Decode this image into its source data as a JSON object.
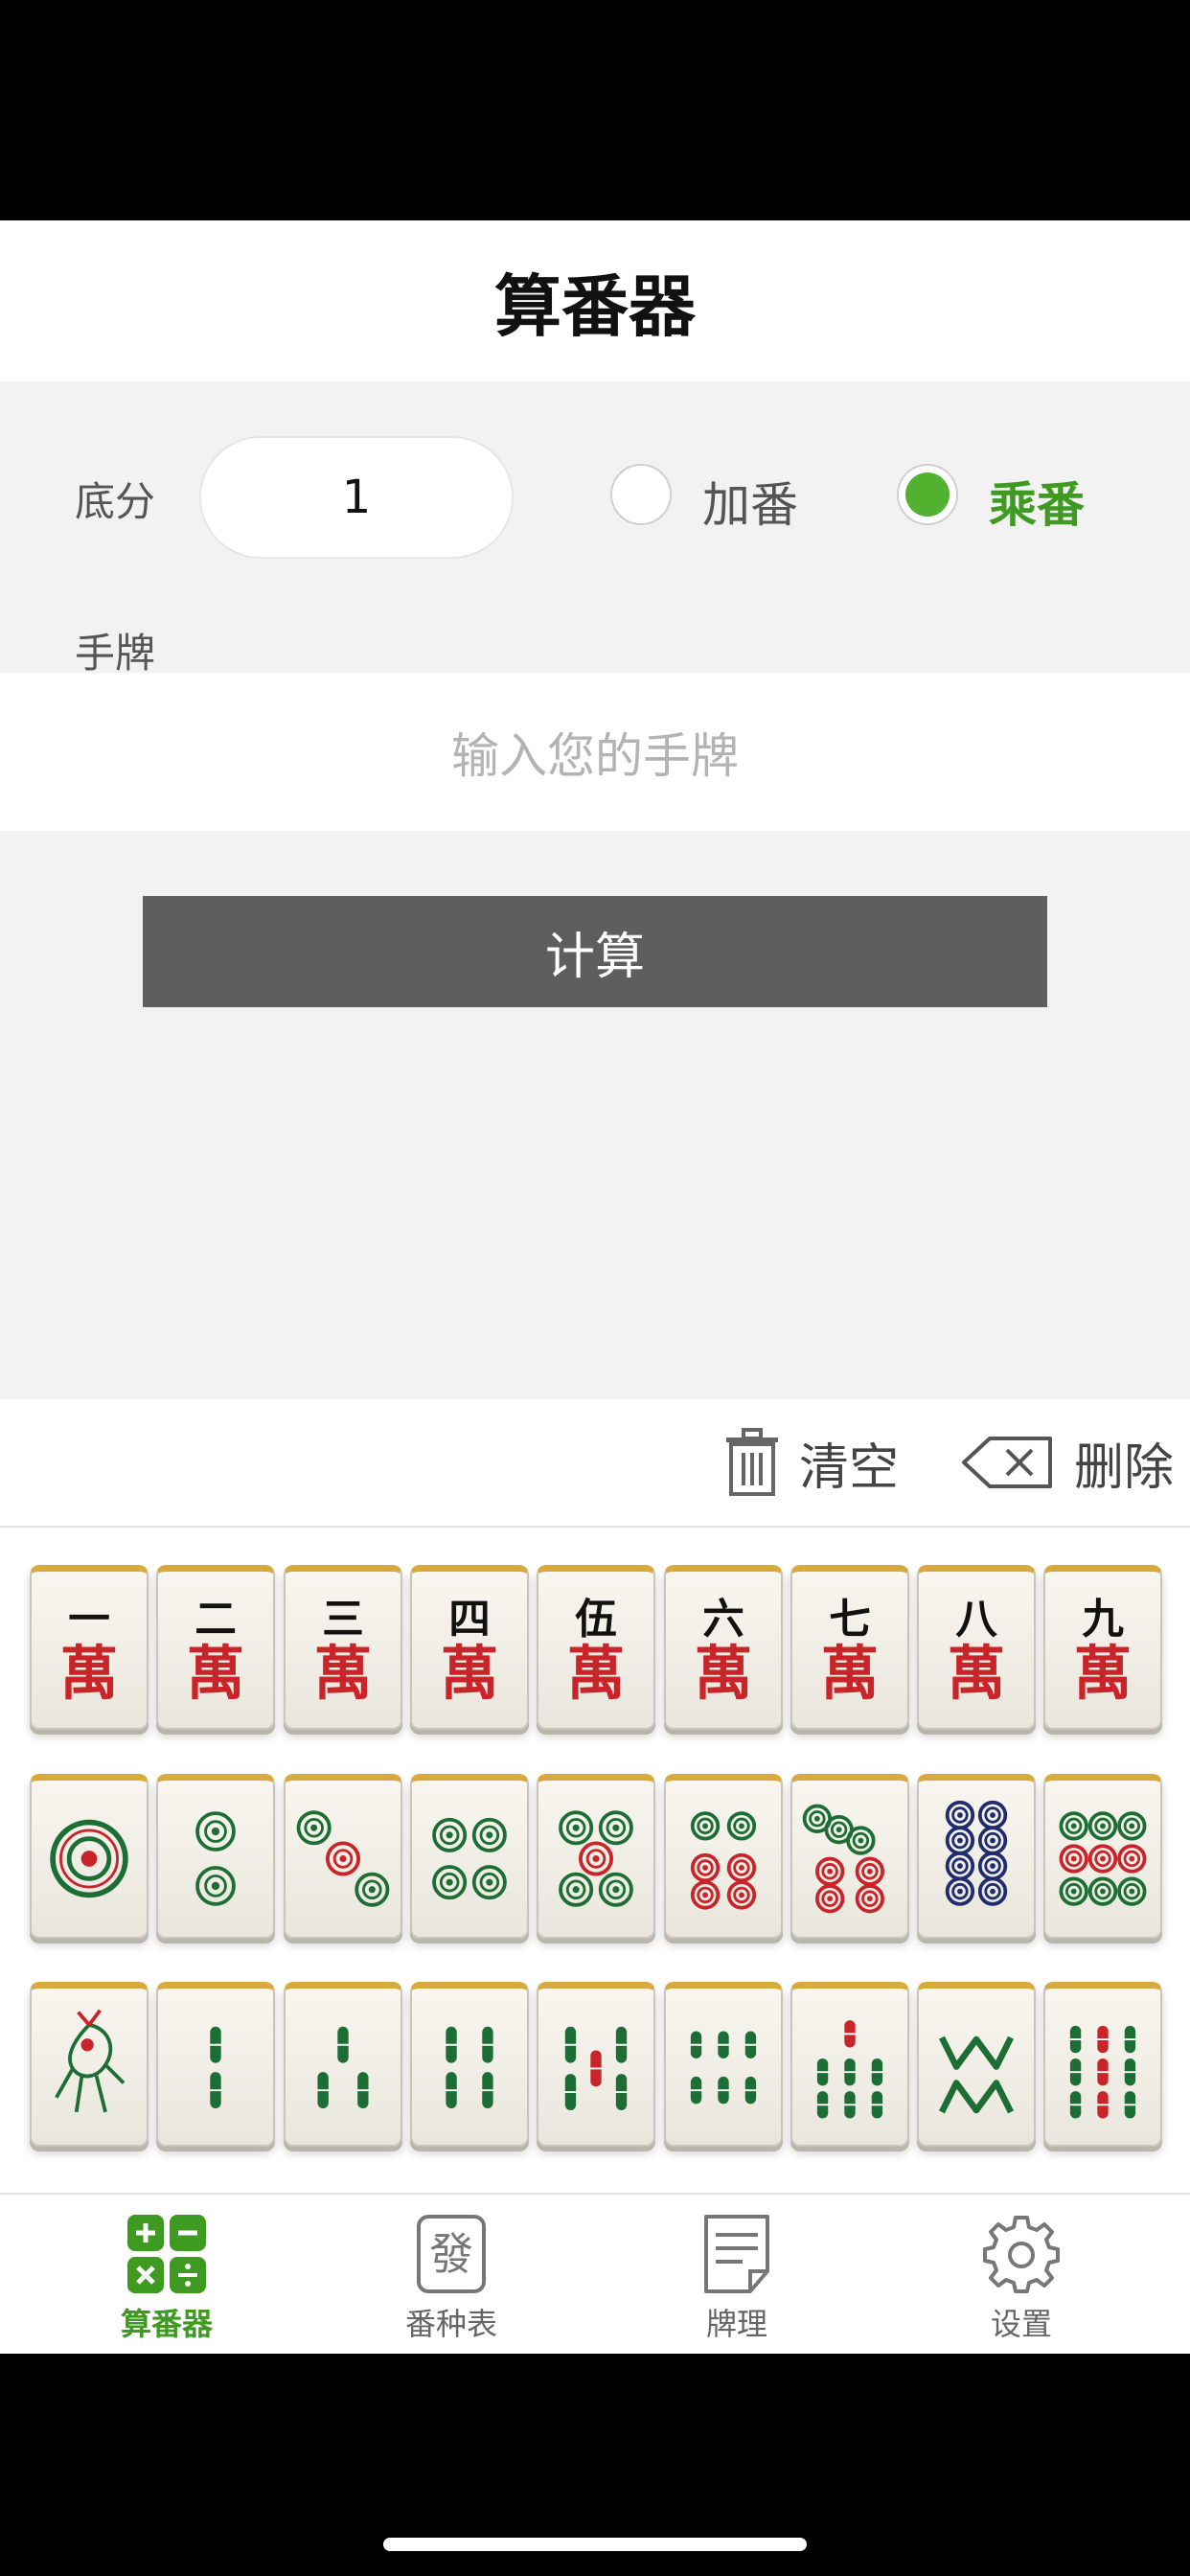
{
  "nav": {
    "title": "算番器"
  },
  "form": {
    "base_label": "底分",
    "base_value": "1",
    "mode_add_label": "加番",
    "mode_mul_label": "乘番",
    "selected_mode": "乘番",
    "hand_label": "手牌",
    "hand_placeholder": "输入您的手牌",
    "calc_button": "计算"
  },
  "keyboard": {
    "clear_label": "清空",
    "delete_label": "删除",
    "tile_rows": [
      {
        "suit": "characters",
        "tiles": [
          "一萬",
          "二萬",
          "三萬",
          "四萬",
          "伍萬",
          "六萬",
          "七萬",
          "八萬",
          "九萬"
        ]
      },
      {
        "suit": "dots",
        "tiles": [
          "一筒",
          "二筒",
          "三筒",
          "四筒",
          "五筒",
          "六筒",
          "七筒",
          "八筒",
          "九筒"
        ]
      },
      {
        "suit": "bamboo",
        "tiles": [
          "一条",
          "二条",
          "三条",
          "四条",
          "五条",
          "六条",
          "七条",
          "八条",
          "九条"
        ]
      }
    ],
    "char_numerals": [
      "一",
      "二",
      "三",
      "四",
      "伍",
      "六",
      "七",
      "八",
      "九"
    ],
    "char_suffix": "萬"
  },
  "tabs": [
    {
      "label": "算番器",
      "icon": "calculator-icon",
      "active": true
    },
    {
      "label": "番种表",
      "icon": "fa-tile-icon",
      "active": false
    },
    {
      "label": "牌理",
      "icon": "document-icon",
      "active": false
    },
    {
      "label": "设置",
      "icon": "gear-icon",
      "active": false
    }
  ],
  "colors": {
    "accent": "#3f9a21",
    "radio_on": "#52b230",
    "button_bg": "#5e5e5e",
    "tile_red": "#c8242a",
    "tile_green": "#1c6e34",
    "tile_blue": "#1f2c6e"
  }
}
